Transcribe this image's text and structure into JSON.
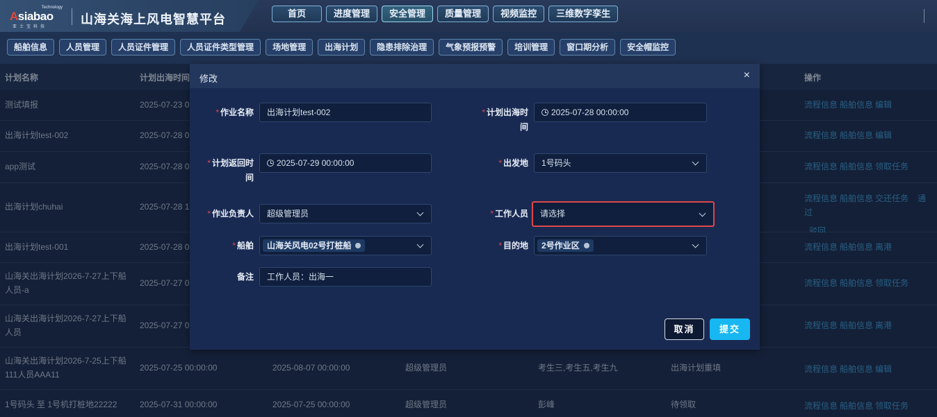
{
  "app": {
    "logo_text": "Asiabao",
    "logo_tech": "Technology",
    "logo_sub": "亚士宝科技",
    "title": "山海关海上风电智慧平台"
  },
  "nav": [
    "首页",
    "进度管理",
    "安全管理",
    "质量管理",
    "视频监控",
    "三维数字孪生"
  ],
  "nav_active": "安全管理",
  "subtabs": [
    "船舶信息",
    "人员管理",
    "人员证件管理",
    "人员证件类型管理",
    "场地管理",
    "出海计划",
    "隐患排除治理",
    "气象预报预警",
    "培训管理",
    "窗口期分析",
    "安全帽监控"
  ],
  "table": {
    "headers": {
      "name": "计划名称",
      "out_time": "计划出海时间",
      "ops": "操作"
    },
    "rows": [
      {
        "name": "测试填报",
        "out": "2025-07-23 0",
        "ret": "",
        "owner": "",
        "staff": "",
        "status": "",
        "ops": [
          "流程信息",
          "船舶信息",
          "编辑"
        ]
      },
      {
        "name": "出海计划test-002",
        "out": "2025-07-28 0",
        "ret": "",
        "owner": "",
        "staff": "",
        "status": "",
        "ops": [
          "流程信息",
          "船舶信息",
          "编辑"
        ]
      },
      {
        "name": "app测试",
        "out": "2025-07-28 0",
        "ret": "",
        "owner": "",
        "staff": "",
        "status": "",
        "ops": [
          "流程信息",
          "船舶信息",
          "领取任务"
        ]
      },
      {
        "name": "出海计划chuhai",
        "out": "2025-07-28 1",
        "ret": "",
        "owner": "",
        "staff": "",
        "status": "",
        "ops": [
          "流程信息",
          "船舶信息",
          "交还任务",
          "通过",
          "驳回"
        ]
      },
      {
        "name": "出海计划test-001",
        "out": "2025-07-28 0",
        "ret": "",
        "owner": "",
        "staff": "",
        "status": "",
        "ops": [
          "流程信息",
          "船舶信息",
          "离港"
        ]
      },
      {
        "name": "山海关出海计划2026-7-27上下船人员-a",
        "out": "2025-07-27 0",
        "ret": "",
        "owner": "",
        "staff": "",
        "status": "",
        "ops": [
          "流程信息",
          "船舶信息",
          "领取任务"
        ]
      },
      {
        "name": "山海关出海计划2026-7-27上下船人员",
        "out": "2025-07-27 0",
        "ret": "",
        "owner": "",
        "staff": "",
        "status": "",
        "ops": [
          "流程信息",
          "船舶信息",
          "离港"
        ]
      },
      {
        "name": "山海关出海计划2026-7-25上下船111人员AAA11",
        "out": "2025-07-25 00:00:00",
        "ret": "2025-08-07 00:00:00",
        "owner": "超级管理员",
        "staff": "考生三,考生五,考生九",
        "status": "出海计划重填",
        "ops": [
          "流程信息",
          "船舶信息",
          "编辑"
        ]
      },
      {
        "name": "1号码头 至 1号机打桩地22222",
        "out": "2025-07-31 00:00:00",
        "ret": "2025-07-25 00:00:00",
        "owner": "超级管理员",
        "staff": "彭峰",
        "status": "待领取",
        "ops": [
          "流程信息",
          "船舶信息",
          "领取任务"
        ]
      }
    ]
  },
  "dialog": {
    "title": "修改",
    "close": "×",
    "fields": {
      "job_name": {
        "label": "作业名称",
        "value": "出海计划test-002"
      },
      "out_time": {
        "label_1": "计划出海时",
        "label_2": "间",
        "value": "2025-07-28 00:00:00"
      },
      "return_time": {
        "label_1": "计划返回时",
        "label_2": "间",
        "value": "2025-07-29 00:00:00"
      },
      "departure": {
        "label": "出发地",
        "value": "1号码头"
      },
      "owner": {
        "label": "作业负责人",
        "value": "超级管理员"
      },
      "staff": {
        "label": "工作人员",
        "placeholder": "请选择"
      },
      "ship": {
        "label": "船舶",
        "tag": "山海关风电02号打桩船"
      },
      "destination": {
        "label": "目的地",
        "tag": "2号作业区"
      },
      "remark": {
        "label": "备注",
        "value": "工作人员：出海一"
      }
    },
    "cancel": "取消",
    "submit": "提交"
  }
}
